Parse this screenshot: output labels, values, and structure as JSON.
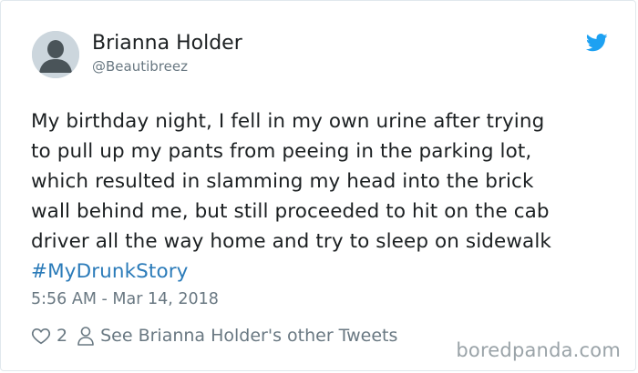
{
  "tweet": {
    "author_name": "Brianna Holder",
    "author_handle": "@Beautibreez",
    "text_lines": [
      "My birthday night, I fell in my own urine after trying",
      "to pull up my pants from peeing in the parking lot,",
      "which resulted in slamming my head into the brick",
      "wall behind me, but still proceeded to hit on the cab",
      "driver all the way home and try to sleep on sidewalk"
    ],
    "hashtag": "#MyDrunkStory",
    "timestamp": "5:56 AM - Mar 14, 2018",
    "like_count": "2",
    "see_more_label": "See Brianna Holder's other Tweets"
  },
  "watermark": "boredpanda.com",
  "colors": {
    "text": "#1c2022",
    "secondary": "#697882",
    "link": "#2b7bb9",
    "twitter_blue": "#1da1f2",
    "avatar_bg": "#ccd6dd"
  },
  "icons": {
    "avatar": "default-avatar-icon",
    "brand": "twitter-bird-icon",
    "like": "heart-icon",
    "profile": "person-icon"
  }
}
